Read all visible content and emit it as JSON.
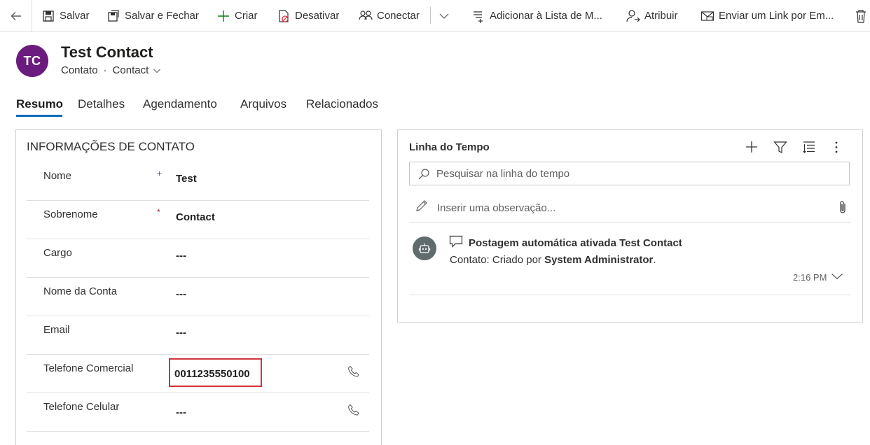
{
  "toolbar": {
    "save": "Salvar",
    "save_close": "Salvar e Fechar",
    "create": "Criar",
    "deactivate": "Desativar",
    "connect": "Conectar",
    "add_to_list": "Adicionar à Lista de M...",
    "assign": "Atribuir",
    "email_link": "Enviar um Link por Em..."
  },
  "header": {
    "initials": "TC",
    "title": "Test Contact",
    "entity": "Contato",
    "separator": "·",
    "form": "Contact"
  },
  "tabs": [
    {
      "label": "Resumo",
      "active": true
    },
    {
      "label": "Detalhes"
    },
    {
      "label": "Agendamento"
    },
    {
      "label": "Arquivos"
    },
    {
      "label": "Relacionados"
    }
  ],
  "contact_info": {
    "section_title": "INFORMAÇÕES DE CONTATO",
    "fields": [
      {
        "label": "Nome",
        "required": "+",
        "value": "Test"
      },
      {
        "label": "Sobrenome",
        "required": "*",
        "value": "Contact"
      },
      {
        "label": "Cargo",
        "value": "---"
      },
      {
        "label": "Nome da Conta",
        "value": "---"
      },
      {
        "label": "Email",
        "value": "---"
      },
      {
        "label": "Telefone Comercial",
        "value": "0011235550100"
      },
      {
        "label": "Telefone Celular",
        "value": "---"
      }
    ]
  },
  "timeline": {
    "title": "Linha do Tempo",
    "search_placeholder": "Pesquisar na linha do tempo",
    "note_placeholder": "Inserir uma observação...",
    "post": {
      "title": "Postagem automática ativada Test Contact",
      "body_prefix": "Contato: Criado por ",
      "body_user": "System Administrator",
      "body_suffix": ".",
      "time": "2:16 PM"
    }
  },
  "colors": {
    "avatar": "#6b1b7e",
    "accent": "#0f6cbd",
    "required": "#a4262c",
    "highlight": "#d13438"
  }
}
